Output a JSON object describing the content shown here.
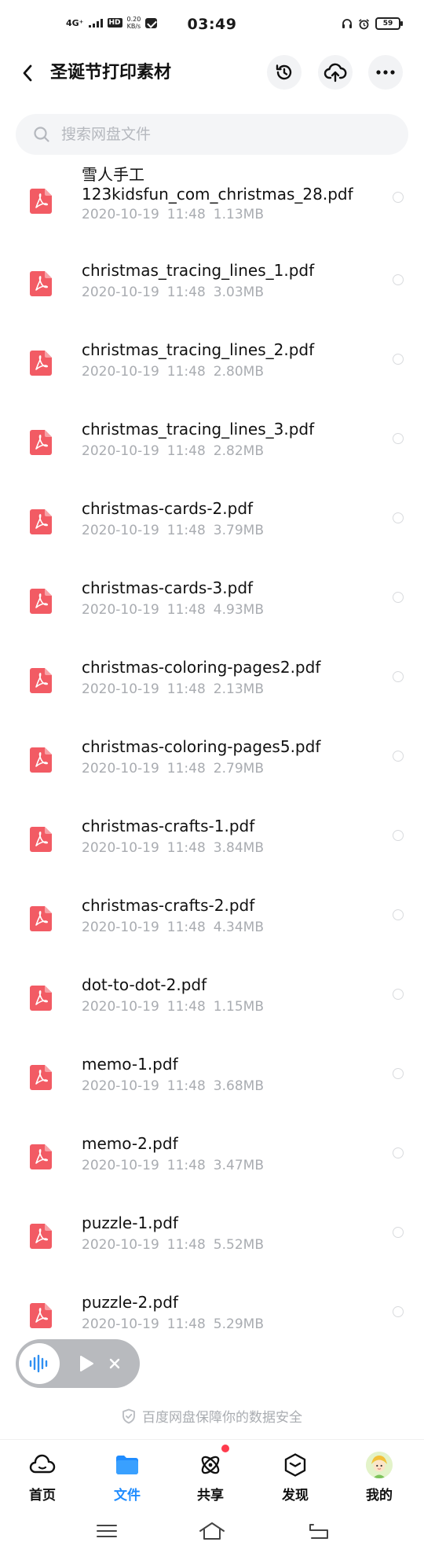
{
  "status_bar": {
    "network": "4G⁺",
    "hd": "HD",
    "speed_value": "0.20",
    "speed_unit": "KB/s",
    "time": "03:49",
    "battery": "59"
  },
  "header": {
    "title": "圣诞节打印素材"
  },
  "search": {
    "placeholder": "搜索网盘文件"
  },
  "files": [
    {
      "name": "雪人手工\n123kidsfun_com_christmas_28.pdf",
      "date": "2020-10-19",
      "time": "11:48",
      "size": "1.13MB"
    },
    {
      "name": "christmas_tracing_lines_1.pdf",
      "date": "2020-10-19",
      "time": "11:48",
      "size": "3.03MB"
    },
    {
      "name": "christmas_tracing_lines_2.pdf",
      "date": "2020-10-19",
      "time": "11:48",
      "size": "2.80MB"
    },
    {
      "name": "christmas_tracing_lines_3.pdf",
      "date": "2020-10-19",
      "time": "11:48",
      "size": "2.82MB"
    },
    {
      "name": "christmas-cards-2.pdf",
      "date": "2020-10-19",
      "time": "11:48",
      "size": "3.79MB"
    },
    {
      "name": "christmas-cards-3.pdf",
      "date": "2020-10-19",
      "time": "11:48",
      "size": "4.93MB"
    },
    {
      "name": "christmas-coloring-pages2.pdf",
      "date": "2020-10-19",
      "time": "11:48",
      "size": "2.13MB"
    },
    {
      "name": "christmas-coloring-pages5.pdf",
      "date": "2020-10-19",
      "time": "11:48",
      "size": "2.79MB"
    },
    {
      "name": "christmas-crafts-1.pdf",
      "date": "2020-10-19",
      "time": "11:48",
      "size": "3.84MB"
    },
    {
      "name": "christmas-crafts-2.pdf",
      "date": "2020-10-19",
      "time": "11:48",
      "size": "4.34MB"
    },
    {
      "name": "dot-to-dot-2.pdf",
      "date": "2020-10-19",
      "time": "11:48",
      "size": "1.15MB"
    },
    {
      "name": "memo-1.pdf",
      "date": "2020-10-19",
      "time": "11:48",
      "size": "3.68MB"
    },
    {
      "name": "memo-2.pdf",
      "date": "2020-10-19",
      "time": "11:48",
      "size": "3.47MB"
    },
    {
      "name": "puzzle-1.pdf",
      "date": "2020-10-19",
      "time": "11:48",
      "size": "5.52MB"
    },
    {
      "name": "puzzle-2.pdf",
      "date": "2020-10-19",
      "time": "11:48",
      "size": "5.29MB"
    }
  ],
  "security_notice": "百度网盘保障你的数据安全",
  "bottom_nav": [
    {
      "label": "首页",
      "icon": "cloud-home-icon",
      "active": false
    },
    {
      "label": "文件",
      "icon": "folder-icon",
      "active": true
    },
    {
      "label": "共享",
      "icon": "share-atom-icon",
      "active": false
    },
    {
      "label": "发现",
      "icon": "discover-icon",
      "active": false
    },
    {
      "label": "我的",
      "icon": "avatar",
      "active": false
    }
  ],
  "colors": {
    "accent": "#1f8cff",
    "pdf_red": "#f25b64",
    "meta_gray": "#a9acb1",
    "badge_red": "#ff3b4d"
  }
}
